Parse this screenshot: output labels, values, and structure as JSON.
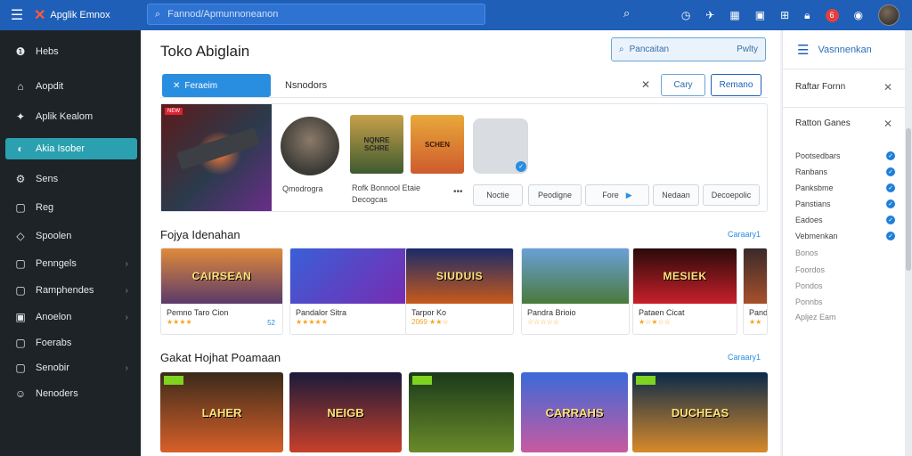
{
  "topbar": {
    "app_name": "Apglik Emnox",
    "search_value": "Fannod/Apmunnoneanon",
    "icons": [
      "clock-icon",
      "plane-icon",
      "grid-icon",
      "calendar-icon",
      "gift-icon",
      "lock-icon",
      "notification-icon",
      "globe-icon"
    ],
    "notification_count": "6"
  },
  "sidebar": {
    "items": [
      {
        "label": "Hebs",
        "icon": "info-icon",
        "chevron": false
      },
      {
        "label": "Aopdit",
        "icon": "home-icon",
        "chevron": false
      },
      {
        "label": "Aplik Kealom",
        "icon": "app-icon",
        "chevron": false
      },
      {
        "label": "Akia Isober",
        "icon": "toggle-icon",
        "chevron": false,
        "active": true
      },
      {
        "label": "Sens",
        "icon": "gear-icon",
        "chevron": false
      },
      {
        "label": "Reg",
        "icon": "doc-icon",
        "chevron": false
      },
      {
        "label": "Spoolen",
        "icon": "tag-icon",
        "chevron": false
      },
      {
        "label": "Penngels",
        "icon": "box-icon",
        "chevron": true
      },
      {
        "label": "Ramphendes",
        "icon": "box-icon",
        "chevron": true
      },
      {
        "label": "Anoelon",
        "icon": "calendar-icon",
        "chevron": true
      },
      {
        "label": "Foerabs",
        "icon": "box-icon",
        "chevron": false
      },
      {
        "label": "Senobir",
        "icon": "box-icon",
        "chevron": true
      },
      {
        "label": "Nenoders",
        "icon": "people-icon",
        "chevron": false
      }
    ]
  },
  "main": {
    "title": "Toko Abiglain",
    "search_box": {
      "placeholder": "Pancaitan",
      "right_label": "Pwlty"
    },
    "filter": {
      "button_label": "Feraeim",
      "label": "Nsnodors",
      "cari_label": "Cary",
      "renn_label": "Remano"
    },
    "feature": {
      "hero_tag": "NEW",
      "avatar_name": "Qmodrogra",
      "tile1_lines": [
        "NQNRE",
        "SCHRE"
      ],
      "tile2_text": "SCHEN",
      "meta_line1": "Rofk Bonnool Etaie",
      "meta_line2": "Decogcas",
      "chips": [
        "Noctie",
        "Peodigne",
        "Fore",
        "Nedaan",
        "Decoepolic"
      ]
    },
    "section1": {
      "title": "Fojya Idenahan",
      "link": "Caraary1",
      "cards": [
        {
          "thumb_text": "CAIRSEAN",
          "title": "Pemno Taro Cion",
          "rating": "★★★★",
          "count": "52",
          "bg": "linear-gradient(#e08a3a,#5a3a6a)"
        },
        {
          "thumb_text": "",
          "title": "Pandalor Sitra",
          "rating": "★★★★★",
          "count": "",
          "bg": "linear-gradient(135deg,#3a5fd8,#7a2ab0)"
        },
        {
          "thumb_text": "SIUDUIS",
          "title": "Tarpor Ko",
          "rating": "2069 ★★☆",
          "count": "",
          "bg": "linear-gradient(#1a2a6a,#c85a1a)"
        },
        {
          "thumb_text": "",
          "title": "Pandra Brioio",
          "rating": "☆☆☆☆☆",
          "count": "",
          "bg": "linear-gradient(#6aa0d8,#4a7a3a)"
        },
        {
          "thumb_text": "MESIEK",
          "title": "Pataen Cicat",
          "rating": "★☆★☆☆",
          "count": "",
          "bg": "linear-gradient(#2a0a0a,#c8202a)"
        },
        {
          "thumb_text": "",
          "title": "Pandr",
          "rating": "★★",
          "count": "",
          "bg": "linear-gradient(#3a2a2a,#a8502a)"
        }
      ]
    },
    "section2": {
      "title": "Gakat Hojhat Poamaan",
      "link": "Caraary1",
      "cards": [
        {
          "thumb_text": "LAHER",
          "bg": "linear-gradient(#3a2a1a,#d8602a)"
        },
        {
          "thumb_text": "NEIGB",
          "bg": "linear-gradient(#1a1a3a,#c8402a)"
        },
        {
          "thumb_text": "",
          "bg": "linear-gradient(#1a3a1a,#6a8a2a)"
        },
        {
          "thumb_text": "CARRAHS",
          "bg": "linear-gradient(#3a6ad8,#c85aa0)"
        },
        {
          "thumb_text": "DUCHEAS",
          "bg": "linear-gradient(#0a2a4a,#d88a2a)"
        }
      ]
    }
  },
  "right_panel": {
    "title": "Vasnnenkan",
    "sub1": "Raftar Fornn",
    "sub2": "Ratton Ganes",
    "options_checked": [
      "Pootsedbars",
      "Ranbans",
      "Panksbme",
      "Panstians",
      "Eadoes",
      "Vebmenkan"
    ],
    "options_plain": [
      "Bonos",
      "Foordos",
      "Pondos",
      "Ponnbs",
      "Apljez Eam"
    ]
  },
  "colors": {
    "accent": "#1f5fb8",
    "active": "#2aa0b0",
    "link": "#2a8ee0"
  }
}
